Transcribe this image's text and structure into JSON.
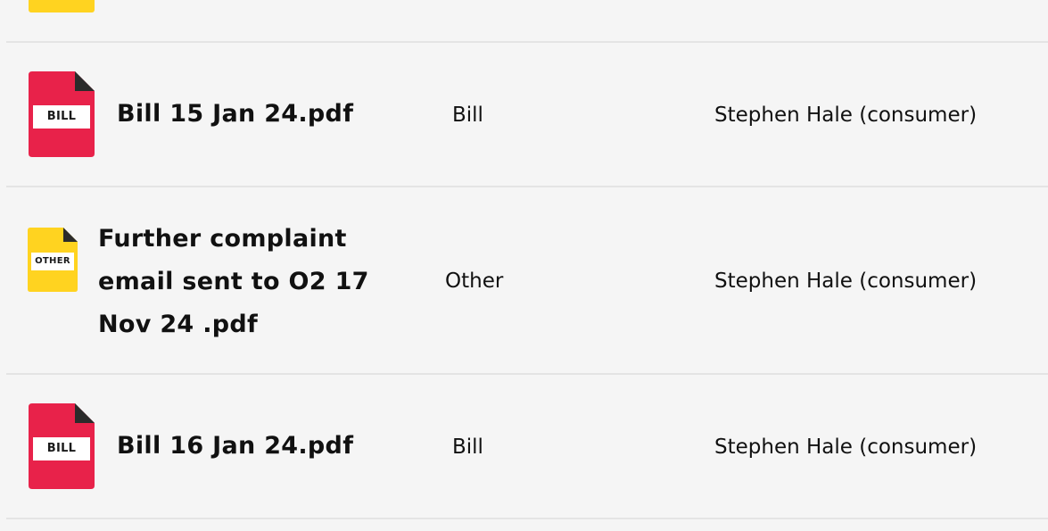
{
  "colors": {
    "bill_icon": "#e8224a",
    "other_icon": "#ffd320",
    "icon_fold": "#2b2b2b",
    "row_divider": "#e4e4e4",
    "background": "#f5f5f5"
  },
  "documents": [
    {
      "file_name": "Bill 15 Jan 24.pdf",
      "type": "Bill",
      "uploaded_by": "Stephen Hale (consumer)",
      "icon": "bill-document-icon",
      "icon_label": "BILL"
    },
    {
      "file_name": "Further complaint email sent to O2 17 Nov 24 .pdf",
      "type": "Other",
      "uploaded_by": "Stephen Hale (consumer)",
      "icon": "other-document-icon",
      "icon_label": "OTHER"
    },
    {
      "file_name": "Bill 16 Jan 24.pdf",
      "type": "Bill",
      "uploaded_by": "Stephen Hale (consumer)",
      "icon": "bill-document-icon",
      "icon_label": "BILL"
    }
  ]
}
